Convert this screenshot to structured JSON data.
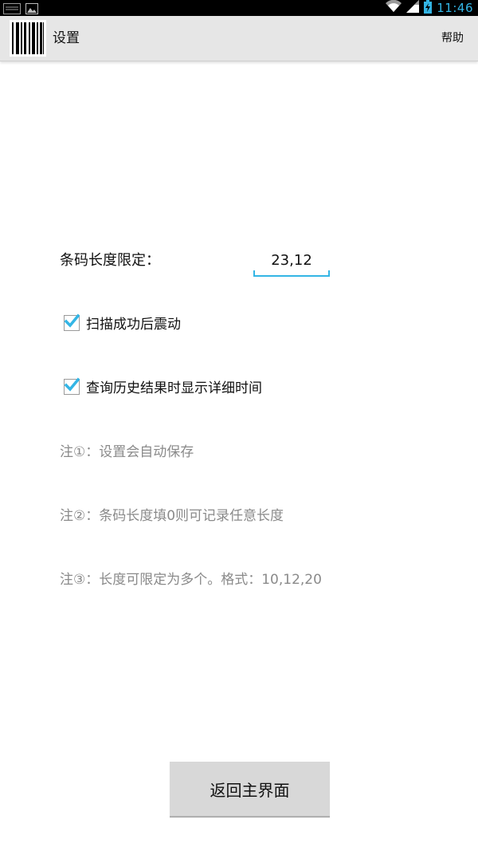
{
  "status_bar": {
    "time": "11:46",
    "icons": [
      "screenshot-icon",
      "image-icon",
      "wifi-icon",
      "signal-icon",
      "battery-charging-icon"
    ]
  },
  "action_bar": {
    "title": "设置",
    "help_label": "帮助",
    "app_icon": "barcode-icon"
  },
  "settings": {
    "barcode_length_label": "条码长度限定：",
    "barcode_length_value": "23,12",
    "vibrate": {
      "label": "扫描成功后震动",
      "checked": true
    },
    "show_time": {
      "label": "查询历史结果时显示详细时间",
      "checked": true
    }
  },
  "notes": [
    "注①：设置会自动保存",
    "注②：条码长度填0则可记录任意长度",
    "注③：长度可限定为多个。格式：10,12,20"
  ],
  "return_button_label": "返回主界面",
  "colors": {
    "accent": "#33b5e5",
    "action_bar": "#e6e6e6",
    "note_text": "#8a8a8a",
    "button": "#d8d8d8"
  }
}
